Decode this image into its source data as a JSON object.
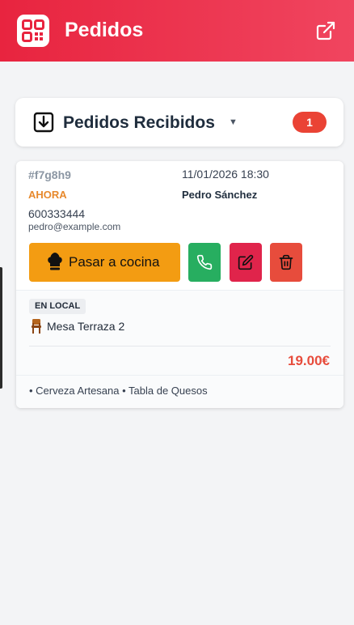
{
  "header": {
    "title": "Pedidos",
    "logo_icon": "qr-grid-icon",
    "external_icon": "external-link-icon",
    "colors": {
      "start": "#e8243f",
      "end": "#f0455f"
    }
  },
  "section": {
    "icon": "inbox-download-icon",
    "title": "Pedidos Recibidos",
    "caret": "▼",
    "count": "1"
  },
  "order": {
    "id": "#f7g8h9",
    "datetime": "11/01/2026 18:30",
    "when": "AHORA",
    "customer_name": "Pedro Sánchez",
    "phone": "600333444",
    "email": "pedro@example.com",
    "actions": {
      "kitchen_label": "Pasar a cocina",
      "kitchen_icon": "chef-hat-icon",
      "phone_icon": "phone-icon",
      "edit_icon": "edit-icon",
      "delete_icon": "trash-icon"
    },
    "type_badge": "EN LOCAL",
    "table_icon": "chair-icon",
    "table": "Mesa Terraza 2",
    "total": "19.00€",
    "items_text": "• Cerveza Artesana • Tabla de Quesos"
  }
}
